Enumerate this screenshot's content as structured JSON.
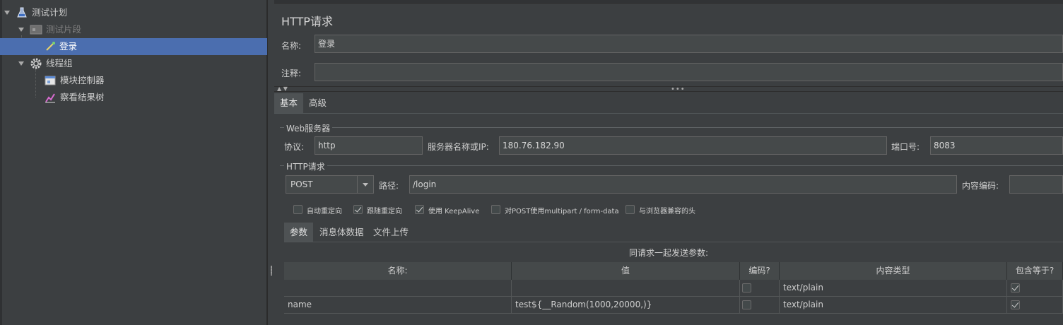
{
  "tree": {
    "items": [
      {
        "label": "测试计划",
        "icon": "flask-icon"
      },
      {
        "label": "测试片段",
        "icon": "fragment-icon"
      },
      {
        "label": "登录",
        "icon": "pipette-icon"
      },
      {
        "label": "线程组",
        "icon": "gear-icon"
      },
      {
        "label": "模块控制器",
        "icon": "module-icon"
      },
      {
        "label": "察看结果树",
        "icon": "chart-icon"
      }
    ]
  },
  "panel": {
    "title": "HTTP请求",
    "name_label": "名称:",
    "name_value": "登录",
    "comment_label": "注释:",
    "comment_value": "",
    "tabs": [
      "基本",
      "高级"
    ],
    "web_server": {
      "group_title": "Web服务器",
      "protocol_label": "协议:",
      "protocol_value": "http",
      "server_label": "服务器名称或IP:",
      "server_value": "180.76.182.90",
      "port_label": "端口号:",
      "port_value": "8083"
    },
    "http_request": {
      "group_title": "HTTP请求",
      "method": "POST",
      "path_label": "路径:",
      "path_value": "/login",
      "encoding_label": "内容编码:",
      "encoding_value": ""
    },
    "options": [
      {
        "label": "自动重定向",
        "checked": false
      },
      {
        "label": "跟随重定向",
        "checked": true
      },
      {
        "label": "使用 KeepAlive",
        "checked": true
      },
      {
        "label": "对POST使用multipart / form-data",
        "checked": false
      },
      {
        "label": "与浏览器兼容的头",
        "checked": false
      }
    ],
    "sub_tabs": [
      "参数",
      "消息体数据",
      "文件上传"
    ],
    "params_caption": "同请求一起发送参数:",
    "params_headers": [
      "名称:",
      "值",
      "编码?",
      "内容类型",
      "包含等于?"
    ],
    "params_rows": [
      {
        "name": "",
        "value": "",
        "encode": false,
        "content_type": "text/plain",
        "include_equals": true
      },
      {
        "name": "name",
        "value": "test${__Random(1000,20000,)}",
        "encode": false,
        "content_type": "text/plain",
        "include_equals": true
      }
    ]
  }
}
